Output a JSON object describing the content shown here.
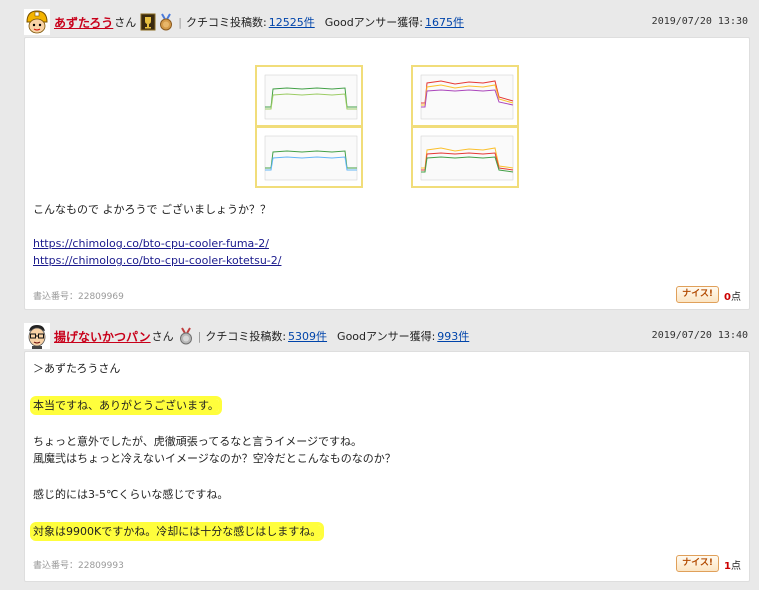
{
  "posts": [
    {
      "username": "あずたろう",
      "honorific": "さん",
      "kuchikomi_label": "クチコミ投稿数:",
      "kuchikomi_count": "12525件",
      "good_label": "Goodアンサー獲得:",
      "good_count": "1675件",
      "date": "2019/07/20 13:30",
      "lines": [
        "こんなもので よかろうで ございましょうか？？"
      ],
      "links": [
        "https://chimolog.co/bto-cpu-cooler-fuma-2/",
        "https://chimolog.co/bto-cpu-cooler-kotetsu-2/"
      ],
      "post_number": "書込番号：22809969",
      "nice_label": "ナイス!",
      "nice_count": "0",
      "nice_unit": "点"
    },
    {
      "username": "揚げないかつパン",
      "honorific": "さん",
      "kuchikomi_label": "クチコミ投稿数:",
      "kuchikomi_count": "5309件",
      "good_label": "Goodアンサー獲得:",
      "good_count": "993件",
      "date": "2019/07/20 13:40",
      "lines": [
        "＞あずたろうさん",
        "本当ですね、ありがとうございます。",
        "ちょっと意外でしたが、虎徹頑張ってるなと言うイメージですね。",
        "風魔弐はちょっと冷えないイメージなのか？空冷だとこんなものなのか？",
        "感じ的には3-5℃くらいな感じですね。",
        "対象は9900Kですかね。冷却には十分な感じはしますね。"
      ],
      "post_number": "書込番号：22809993",
      "nice_label": "ナイス!",
      "nice_count": "1",
      "nice_unit": "点"
    }
  ],
  "colors": {
    "highlight": "#fffe3c",
    "username": "#c8001a",
    "link": "#0044aa"
  }
}
